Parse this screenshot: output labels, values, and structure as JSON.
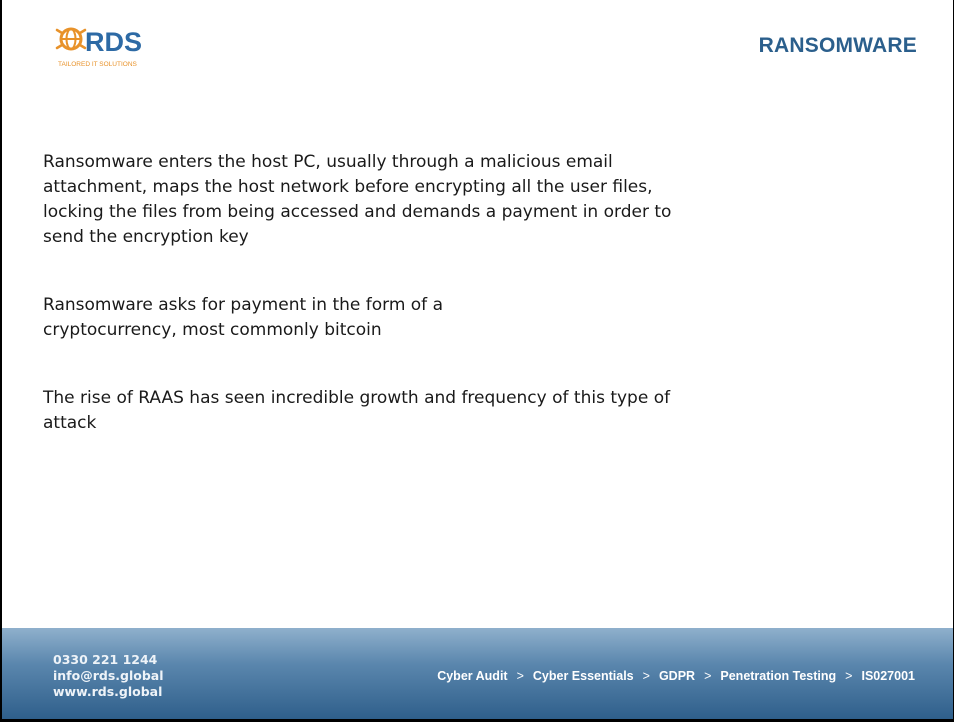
{
  "logo": {
    "wordmark": "RDS",
    "tagline": "TAILORED IT SOLUTIONS"
  },
  "slide": {
    "title": "RANSOMWARE",
    "paragraphs": [
      "Ransomware enters the host PC, usually through a malicious email attachment, maps the host network before encrypting all the user files, locking the files from being accessed and demands a payment in order to send the encryption key",
      "Ransomware asks for payment in the form of a cryptocurrency, most commonly bitcoin",
      "The rise of RAAS has seen incredible growth and frequency of this type of attack"
    ]
  },
  "footer": {
    "phone": "0330 221 1244",
    "email": "info@rds.global",
    "website": "www.rds.global",
    "separator": ">",
    "services": [
      "Cyber Audit",
      "Cyber Essentials",
      "GDPR",
      "Penetration Testing",
      "IS027001"
    ]
  },
  "colors": {
    "title": "#2b5f8c",
    "logo_orange": "#e8922a",
    "logo_blue": "#2d6aa5",
    "footer_dark": "#2f5f8b",
    "footer_light": "#8fb0cc"
  }
}
